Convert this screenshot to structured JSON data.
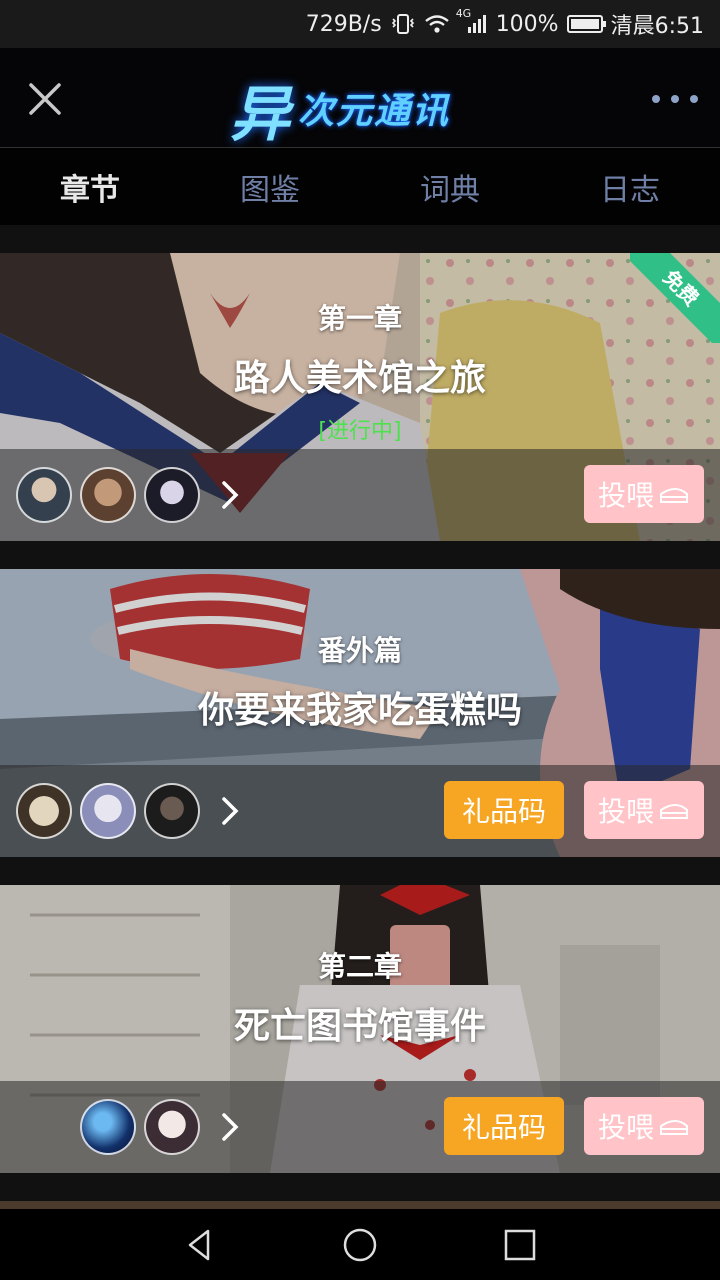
{
  "status_bar": {
    "speed": "729B/s",
    "network": "4G",
    "battery": "100%",
    "battery_level": 1.0,
    "time": "清晨6:51"
  },
  "header": {
    "logo_glyph": "异",
    "logo_text": "次元通讯",
    "close_icon": "close-icon",
    "more_icon": "more-icon"
  },
  "tabs": [
    {
      "label": "章节",
      "active": true
    },
    {
      "label": "图鉴",
      "active": false
    },
    {
      "label": "词典",
      "active": false
    },
    {
      "label": "日志",
      "active": false
    }
  ],
  "chapters": [
    {
      "subtitle": "第一章",
      "title": "路人美术馆之旅",
      "status": "[进行中]",
      "badge": "免费",
      "feed_label": "投喂",
      "gift_label": ""
    },
    {
      "subtitle": "番外篇",
      "title": "你要来我家吃蛋糕吗",
      "status": "",
      "badge": "",
      "feed_label": "投喂",
      "gift_label": "礼品码"
    },
    {
      "subtitle": "第二章",
      "title": "死亡图书馆事件",
      "status": "",
      "badge": "",
      "feed_label": "投喂",
      "gift_label": "礼品码"
    }
  ],
  "colors": {
    "accent_tab_inactive": "#6f7fa5",
    "status_green": "#4ee14e",
    "feed_button": "#ffc3c8",
    "gift_button": "#f6a623",
    "free_badge": "#2fbf87"
  }
}
